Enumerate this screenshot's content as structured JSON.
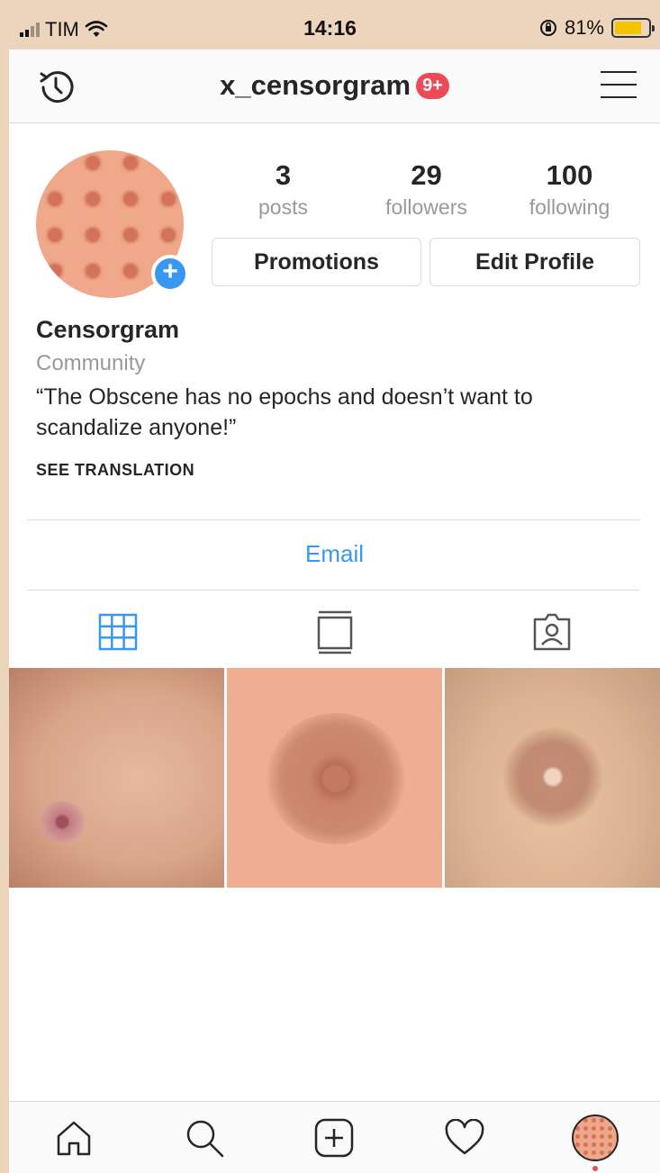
{
  "status_bar": {
    "carrier": "TIM",
    "time": "14:16",
    "battery_percent": "81%",
    "battery_level": 0.81,
    "battery_color": "#f5c400"
  },
  "header": {
    "username": "x_censorgram",
    "notification_badge": "9+",
    "left_icon": "history-icon",
    "right_icon": "menu-icon"
  },
  "profile": {
    "stats": [
      {
        "value": "3",
        "label": "posts"
      },
      {
        "value": "29",
        "label": "followers"
      },
      {
        "value": "100",
        "label": "following"
      }
    ],
    "buttons": {
      "promotions": "Promotions",
      "edit_profile": "Edit Profile"
    },
    "name": "Censorgram",
    "category": "Community",
    "bio": "“The Obscene has no epochs and doesn’t want to scandalize anyone!”",
    "see_translation": "SEE TRANSLATION",
    "contact_button": "Email"
  },
  "tabs": [
    {
      "icon": "grid-icon",
      "active": true
    },
    {
      "icon": "feed-icon",
      "active": false
    },
    {
      "icon": "tagged-icon",
      "active": false
    }
  ],
  "posts": [
    {
      "id": "post-1"
    },
    {
      "id": "post-2"
    },
    {
      "id": "post-3"
    }
  ],
  "bottom_nav": [
    {
      "icon": "home-icon"
    },
    {
      "icon": "search-icon"
    },
    {
      "icon": "add-post-icon"
    },
    {
      "icon": "heart-icon"
    },
    {
      "icon": "profile-avatar-icon"
    }
  ],
  "colors": {
    "accent_blue": "#3897f0",
    "badge_red": "#ed4956",
    "page_background": "#edd4bc"
  }
}
